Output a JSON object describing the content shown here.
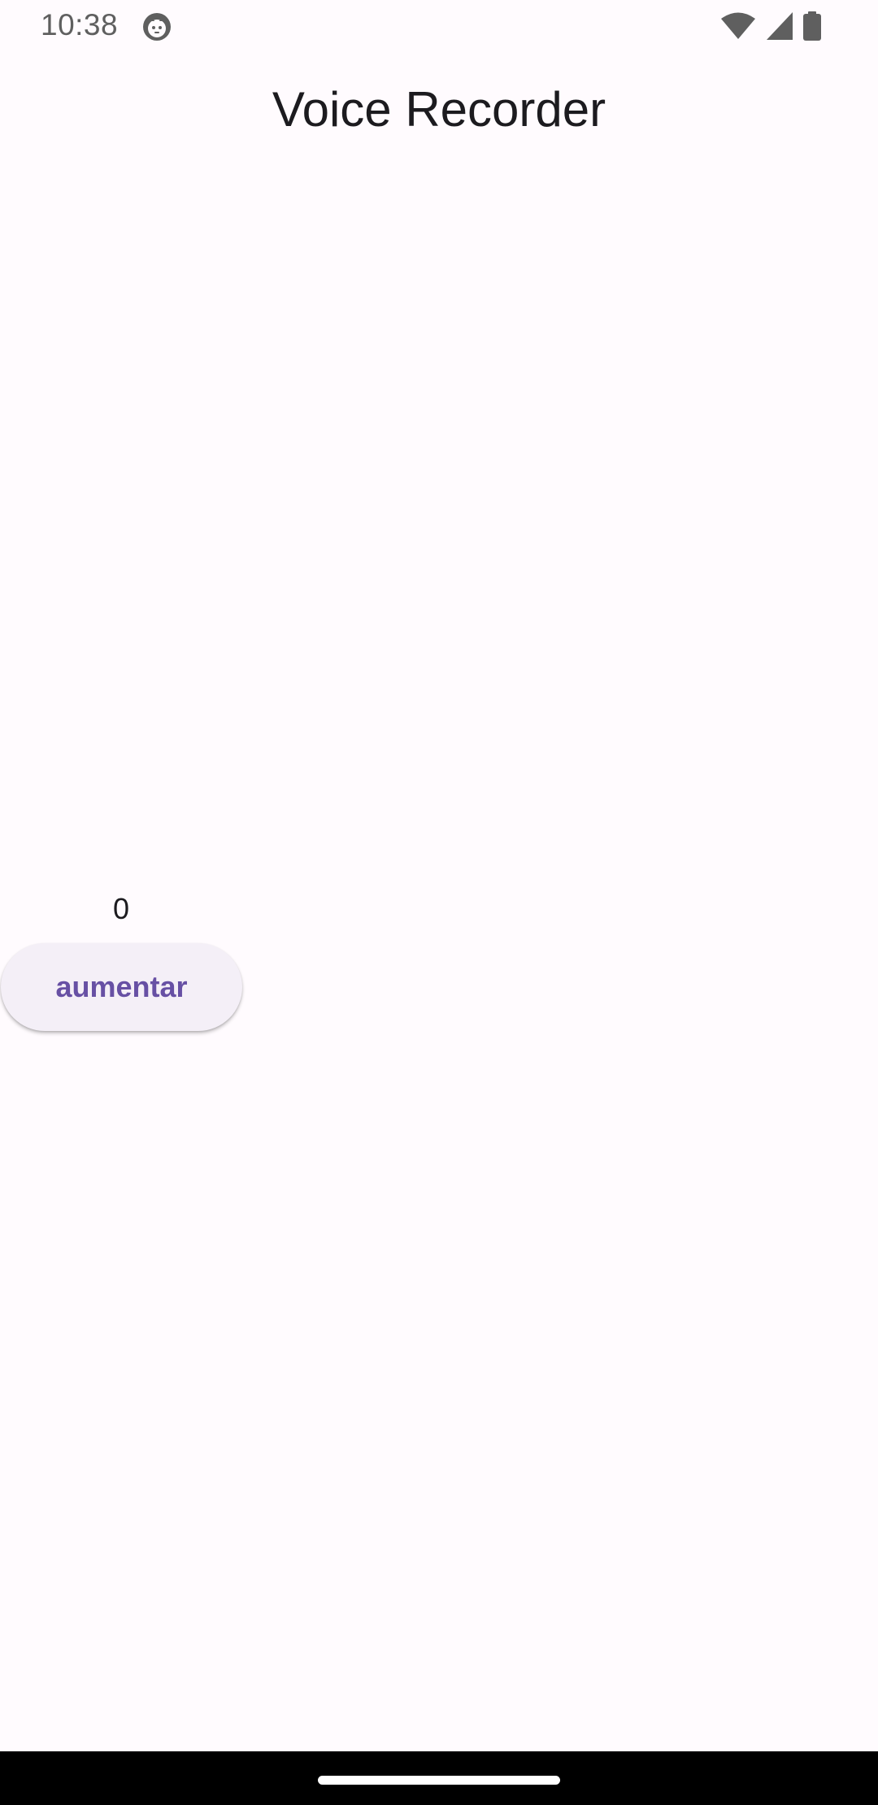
{
  "status_bar": {
    "time": "10:38",
    "app_icon": "android-notification-icon",
    "wifi_icon": "wifi-icon",
    "signal_icon": "cell-signal-icon",
    "battery_icon": "battery-icon"
  },
  "app": {
    "title": "Voice Recorder"
  },
  "counter": {
    "value": "0"
  },
  "buttons": {
    "aumentar_label": "aumentar"
  },
  "colors": {
    "background": "#fffbfe",
    "button_background": "#f4eff7",
    "button_text": "#6750a4",
    "text_primary": "#1c1b1f",
    "nav_bar": "#000000"
  },
  "navigation": {
    "handle_icon": "gesture-handle"
  }
}
